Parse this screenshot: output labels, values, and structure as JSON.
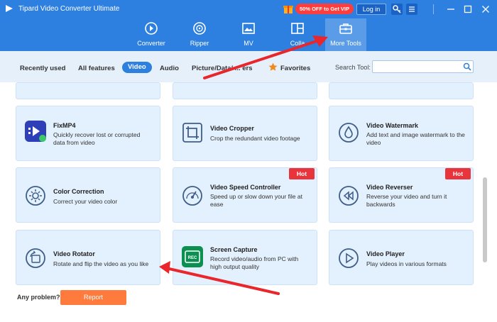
{
  "app": {
    "title": "Tipard Video Converter Ultimate"
  },
  "titlebar": {
    "vip_label": "50% OFF to Get VIP",
    "login_label": "Log in"
  },
  "nav": {
    "converter": "Converter",
    "ripper": "Ripper",
    "mv": "MV",
    "collage": "Colla",
    "more_tools": "More Tools"
  },
  "filters": {
    "recently_used": "Recently used",
    "all_features": "All features",
    "video": "Video",
    "audio": "Audio",
    "picture": "Picture/Data/ ... ers",
    "favorites": "Favorites"
  },
  "search": {
    "label": "Search Tool:",
    "value": ""
  },
  "tools": {
    "fixmp4": {
      "title": "FixMP4",
      "desc": "Quickly recover lost or corrupted data from video"
    },
    "cropper": {
      "title": "Video Cropper",
      "desc": "Crop the redundant video footage"
    },
    "watermark": {
      "title": "Video Watermark",
      "desc": "Add text and image watermark to the video"
    },
    "color": {
      "title": "Color Correction",
      "desc": "Correct your video color"
    },
    "speed": {
      "title": "Video Speed Controller",
      "desc": "Speed up or slow down your file at ease",
      "badge": "Hot"
    },
    "reverser": {
      "title": "Video Reverser",
      "desc": "Reverse your video and turn it backwards",
      "badge": "Hot"
    },
    "rotator": {
      "title": "Video Rotator",
      "desc": "Rotate and flip the video as you like"
    },
    "capture": {
      "title": "Screen Capture",
      "desc": "Record video/audio from PC with high output quality"
    },
    "player": {
      "title": "Video Player",
      "desc": "Play videos in various formats"
    }
  },
  "footer": {
    "problem_label": "Any problem?",
    "report_label": "Report"
  },
  "colors": {
    "header": "#2d7fe0",
    "card": "#e3f0fd",
    "hot": "#e8353c",
    "report": "#ff7a3d",
    "arrow": "#e8262c"
  }
}
